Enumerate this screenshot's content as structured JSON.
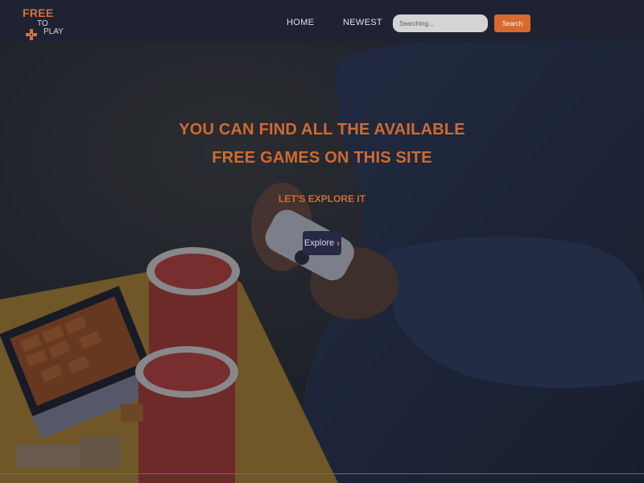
{
  "logo": {
    "line1": "FREE",
    "line2": "TO",
    "line3": "PLAY",
    "icon": "gamepad-cross-icon",
    "color": "#d4733c"
  },
  "nav": {
    "items": [
      {
        "label": "HOME"
      },
      {
        "label": "NEWEST"
      }
    ]
  },
  "search": {
    "placeholder": "Searching...",
    "value": "",
    "button_label": "Search"
  },
  "hero": {
    "heading_line1": "YOU CAN FIND ALL THE AVAILABLE",
    "heading_line2": "FREE GAMES ON THIS SITE",
    "subheading": "LET'S EXPLORE IT",
    "button_label": "Explore",
    "button_icon": "chevron-right-icon",
    "background_image": "person-holding-game-controller-with-dominoes-and-red-cups"
  },
  "colors": {
    "accent": "#d86a2e",
    "header_bg": "#1f2233",
    "heading": "#cf6a35"
  }
}
